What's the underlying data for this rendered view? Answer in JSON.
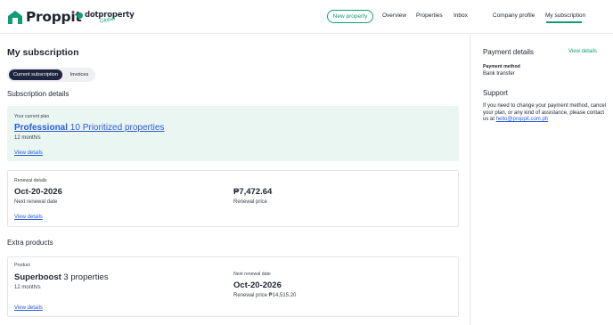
{
  "brand": {
    "name": "Proppit",
    "partner_name": "dotproperty",
    "partner_tag": "Global",
    "accent": "#0f9d75"
  },
  "header": {
    "new_property": "New property",
    "nav": [
      "Overview",
      "Properties",
      "Inbox",
      "Company profile",
      "My subscription"
    ],
    "active_nav": "My subscription"
  },
  "page": {
    "title": "My subscription",
    "tabs": {
      "current": "Current subscription",
      "invoices": "Invoices"
    }
  },
  "subscription": {
    "section_title": "Subscription details",
    "plan": {
      "label": "Your current plan",
      "name_bold": "Professional",
      "name_rest": " 10 Prioritized properties",
      "period": "12 month/s",
      "link": "View details"
    },
    "renewal": {
      "label": "Renewal details",
      "date": "Oct-20-2026",
      "date_caption": "Next renewal date",
      "price": "₱7,472.64",
      "price_caption": "Renewal price",
      "link": "View details"
    }
  },
  "extra": {
    "section_title": "Extra products",
    "product": {
      "label": "Product",
      "name_bold": "Superboost",
      "name_rest": " 3 properties",
      "period": "12 month/s",
      "renewal_label": "Next renewal date",
      "renewal_date": "Oct-20-2026",
      "renewal_price": "Renewal price ₱14,515.20",
      "link": "View details"
    }
  },
  "side": {
    "payment_title": "Payment details",
    "payment_link": "View details",
    "method_label": "Payment method",
    "method_value": "Bank transfer",
    "support_title": "Support",
    "support_text": "If you need to change your payment method, cancel your plan, or any kind of assistance, please contact us at ",
    "support_email": "hello@proppit.com.ph"
  }
}
